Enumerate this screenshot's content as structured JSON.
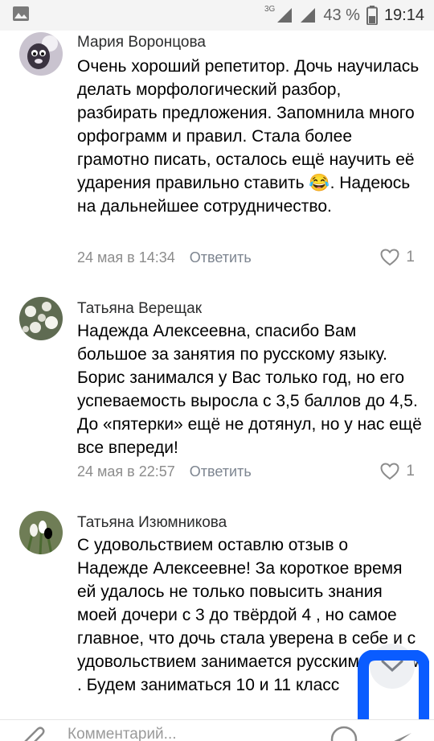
{
  "status_bar": {
    "network_type": "3G",
    "battery_percent": "43 %",
    "time": "19:14"
  },
  "comments": [
    {
      "author": "Мария Воронцова",
      "text_before_emoji": "Очень хороший репетитор. Дочь научилась делать морфологический разбор, разбирать предложения. Запомнила много орфограмм и правил. Стала более грамотно писать, осталось ещё научить её ударения правильно ставить ",
      "emoji": "😂",
      "text_after_emoji": ". Надеюсь на дальнейшее сотрудничество.",
      "date": "24 мая в 14:34",
      "reply_label": "Ответить",
      "likes": "1",
      "avatar_icon": "cartoon-animal-avatar"
    },
    {
      "author": "Татьяна Верещак",
      "text": "Надежда Алексеевна, спасибо Вам большое за занятия по русскому языку. Борис занимался у Вас только год, но его  успеваемость выросла с 3,5 баллов до 4,5. До «пятерки» ещё не дотянул, но у нас ещё все впереди!",
      "date": "24 мая в 22:57",
      "reply_label": "Ответить",
      "likes": "1",
      "avatar_icon": "white-flowers-avatar"
    },
    {
      "author": "Татьяна Изюмникова",
      "text": "С удовольствием оставлю отзыв о Надежде Алексеевне!  За короткое время ей удалось не только повысить знания моей дочери с 3 до твёрдой 4 , но самое главное, что дочь стала уверена в себе и с удовольствием занимается русским языком . Будем заниматься 10 и 11 класс",
      "avatar_icon": "snowdrop-flowers-avatar"
    }
  ],
  "composer": {
    "placeholder": "Комментарий..."
  },
  "colors": {
    "meta_gray": "#8c8c8c",
    "logo_blue": "#0064ff"
  }
}
